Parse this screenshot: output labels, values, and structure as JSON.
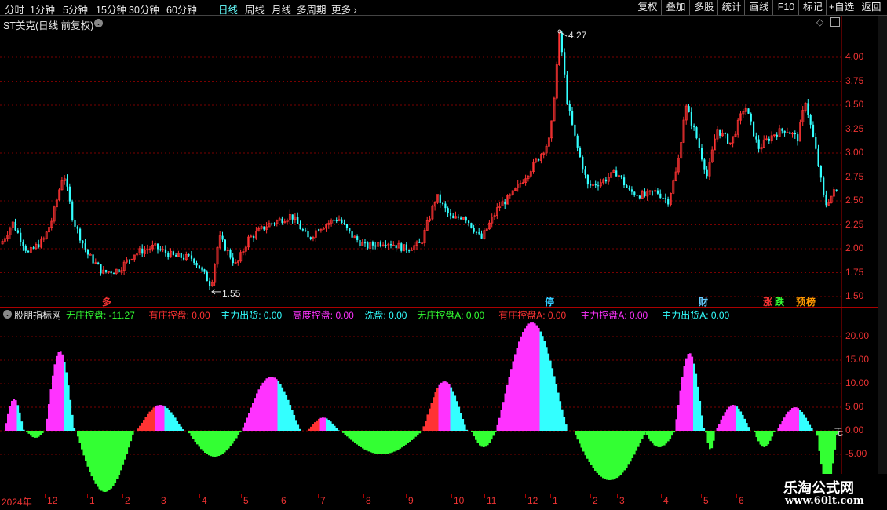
{
  "toolbar": {
    "periods": [
      "分时",
      "1分钟",
      "5分钟",
      "15分钟",
      "30分钟",
      "60分钟",
      "日线",
      "周线",
      "月线",
      "多周期",
      "更多"
    ],
    "active_period": "日线",
    "right_buttons": [
      "复权",
      "叠加",
      "多股",
      "统计",
      "画线",
      "F10",
      "标记",
      "+自选",
      "返回"
    ]
  },
  "main_chart": {
    "title": "ST美克(日线 前复权)",
    "high_marker": "4.27",
    "low_marker": "1.55",
    "price_axis": [
      "4.00",
      "3.75",
      "3.50",
      "3.25",
      "3.00",
      "2.75",
      "2.50",
      "2.25",
      "2.00",
      "1.75",
      "1.50"
    ],
    "event_tags": [
      {
        "text": "多",
        "color": "#e33"
      },
      {
        "text": "停",
        "color": "#3cf"
      },
      {
        "text": "财",
        "color": "#6cf"
      },
      {
        "text": "涨",
        "color": "#e33"
      },
      {
        "text": "跌",
        "color": "#3f3"
      },
      {
        "text": "预",
        "color": "#f90"
      },
      {
        "text": "榜",
        "color": "#f90"
      }
    ]
  },
  "indicator": {
    "name": "股朋指标网",
    "fields": [
      {
        "label": "无庄控盘",
        "value": "-11.27",
        "color": "#3f3"
      },
      {
        "label": "有庄控盘",
        "value": "0.00",
        "color": "#f33"
      },
      {
        "label": "主力出货",
        "value": "0.00",
        "color": "#3ff"
      },
      {
        "label": "高度控盘",
        "value": "0.00",
        "color": "#f3f"
      },
      {
        "label": "洗盘",
        "value": "0.00",
        "color": "#3ff"
      },
      {
        "label": "无庄控盘A",
        "value": "0.00",
        "color": "#3f3"
      },
      {
        "label": "有庄控盘A",
        "value": "0.00",
        "color": "#f33"
      },
      {
        "label": "主力控盘A",
        "value": "0.00",
        "color": "#f3f"
      },
      {
        "label": "主力出货A",
        "value": "0.00",
        "color": "#3ff"
      }
    ],
    "axis": [
      "20.00",
      "15.00",
      "10.00",
      "5.00",
      "0.00",
      "-5.00"
    ],
    "side_label": "无"
  },
  "date_axis": [
    "2024年",
    "12",
    "1",
    "2",
    "3",
    "4",
    "5",
    "6",
    "7",
    "8",
    "9",
    "10",
    "11",
    "12",
    "1",
    "2",
    "3",
    "4",
    "5",
    "6"
  ],
  "watermark": {
    "line1": "乐淘公式网",
    "line2": "www.60lt.com"
  },
  "colors": {
    "up": "#ff3333",
    "down": "#33ffff",
    "grid": "#7a0000",
    "green": "#33ff33",
    "magenta": "#ff33ff",
    "cyan": "#33ffff",
    "red": "#ff3333"
  }
}
